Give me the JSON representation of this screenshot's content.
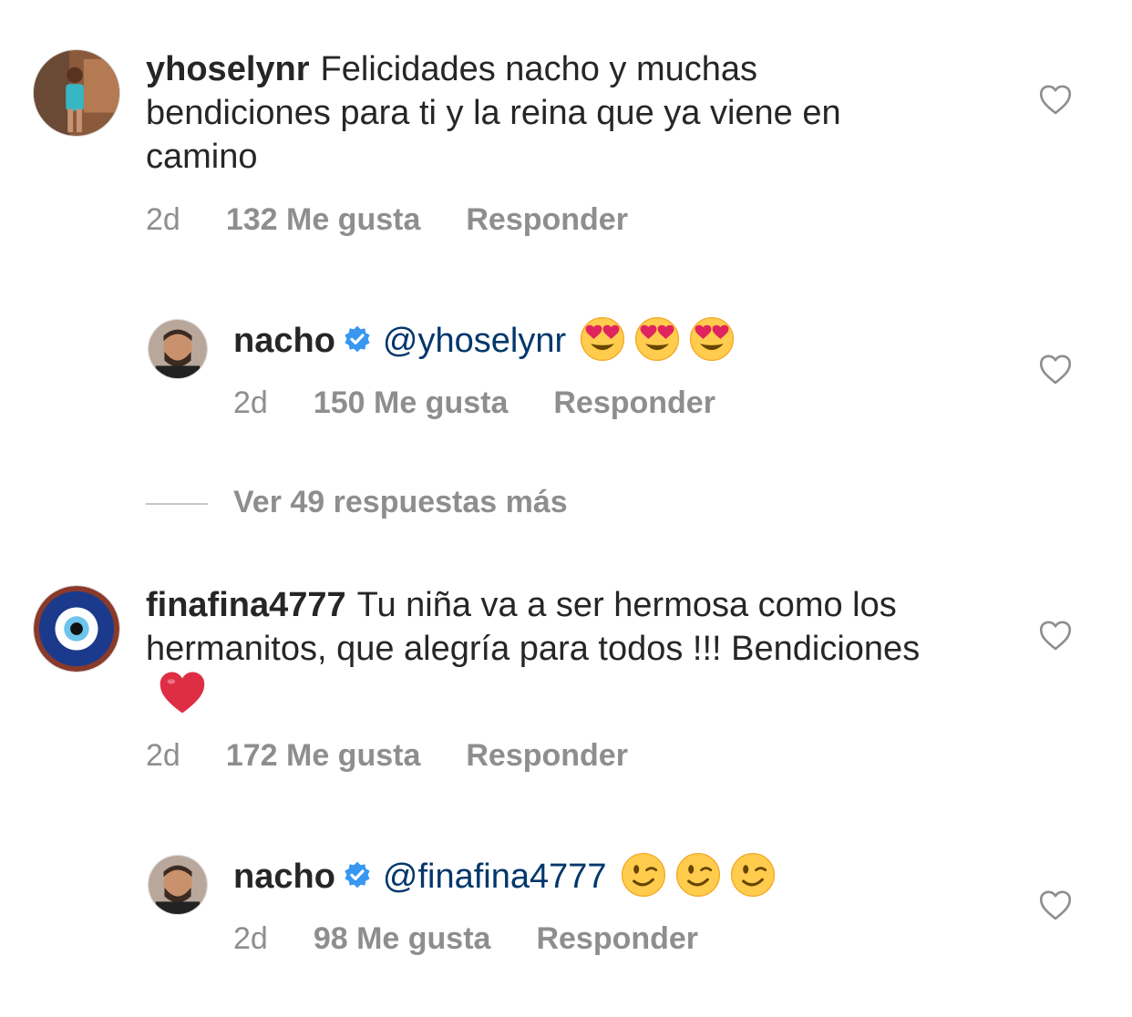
{
  "comments": [
    {
      "username": "yhoselynr",
      "text": "Felicidades nacho y muchas bendiciones para ti y la reina que ya viene en camino",
      "time": "2d",
      "likes": "132 Me gusta",
      "reply_label": "Responder"
    },
    {
      "username": "nacho",
      "verified": true,
      "mention": "@yhoselynr",
      "emojis": [
        "heart-eyes-emoji",
        "heart-eyes-emoji",
        "heart-eyes-emoji"
      ],
      "time": "2d",
      "likes": "150 Me gusta",
      "reply_label": "Responder"
    },
    {
      "username": "finafina4777",
      "text": "Tu niña va a ser hermosa como los hermanitos, que alegría para todos !!! Bendiciones",
      "emojis": [
        "red-heart-emoji"
      ],
      "time": "2d",
      "likes": "172 Me gusta",
      "reply_label": "Responder"
    },
    {
      "username": "nacho",
      "verified": true,
      "mention": "@finafina4777",
      "emojis": [
        "wink-emoji",
        "wink-emoji",
        "wink-emoji"
      ],
      "time": "2d",
      "likes": "98 Me gusta",
      "reply_label": "Responder"
    }
  ],
  "view_more_replies": "Ver 49 respuestas más",
  "colors": {
    "text": "#262626",
    "secondary": "#8e8e8e",
    "mention": "#00376b",
    "verified": "#3897f0"
  }
}
